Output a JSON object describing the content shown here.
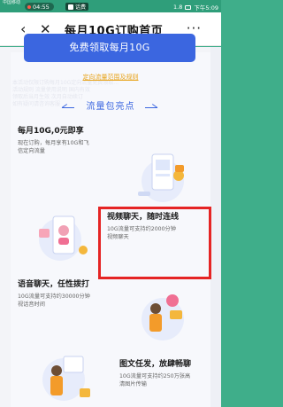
{
  "status_bar": {
    "carrier": "中国移动",
    "time_pill": "04:55",
    "badge": "话费",
    "right_text": "1.8",
    "clock": "下午5:09"
  },
  "nav": {
    "back": "‹",
    "close": "✕",
    "title": "每月10G订购首页",
    "more": "···"
  },
  "cta": {
    "label": "免费领取每月10G"
  },
  "rules_link": "定向流量范围及规则",
  "faint_text": "本活动仅限订购每月10G定向流量免费领取...\n活动规则 流量使用说明 国内有效\n领取后当月生效 次月自动续订\n如有疑问请咨询客服",
  "section": {
    "title": "流量包亮点"
  },
  "features": [
    {
      "title": "每月10G,0元即享",
      "desc": "现在订购，每月享有10G和飞\n信定向流量"
    },
    {
      "title": "视频聊天，随时连线",
      "desc": "10G流量可支持约2000分钟\n视频聊天"
    },
    {
      "title": "语音聊天，任性拨打",
      "desc": "10G流量可支持约30000分钟\n视话音时间"
    },
    {
      "title": "图文任发，放肆畅聊",
      "desc": "10G流量可支持约250万张高\n清图片传输"
    }
  ],
  "colors": {
    "accent": "#3b66e0",
    "highlight": "#e52424",
    "link": "#e8a41c",
    "status_bg": "#2f9e7a"
  },
  "icons": [
    "back-arrow-icon",
    "close-icon",
    "more-icon",
    "arrow-left-icon",
    "arrow-right-icon"
  ]
}
